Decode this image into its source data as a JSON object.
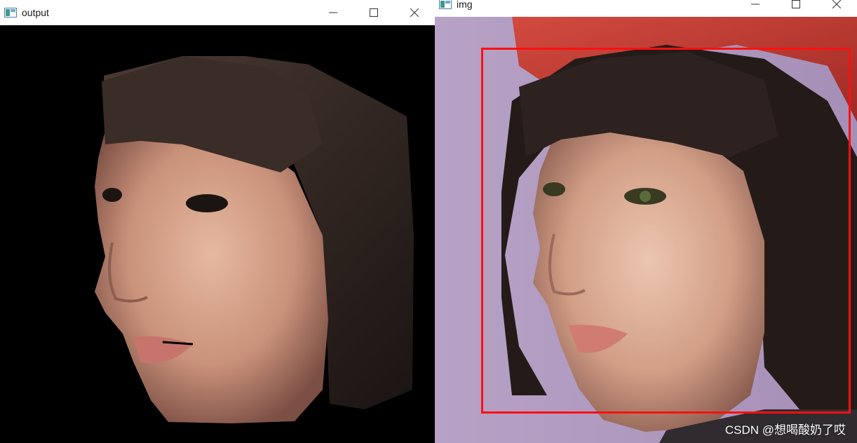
{
  "windows": {
    "output": {
      "title": "output"
    },
    "img": {
      "title": "img"
    }
  },
  "controls": {
    "minimize_icon": "minimize-icon",
    "maximize_icon": "maximize-icon",
    "close_icon": "close-icon"
  },
  "detection": {
    "box_color": "#ff1010"
  },
  "watermark": {
    "text": "CSDN @想喝酸奶了哎"
  }
}
